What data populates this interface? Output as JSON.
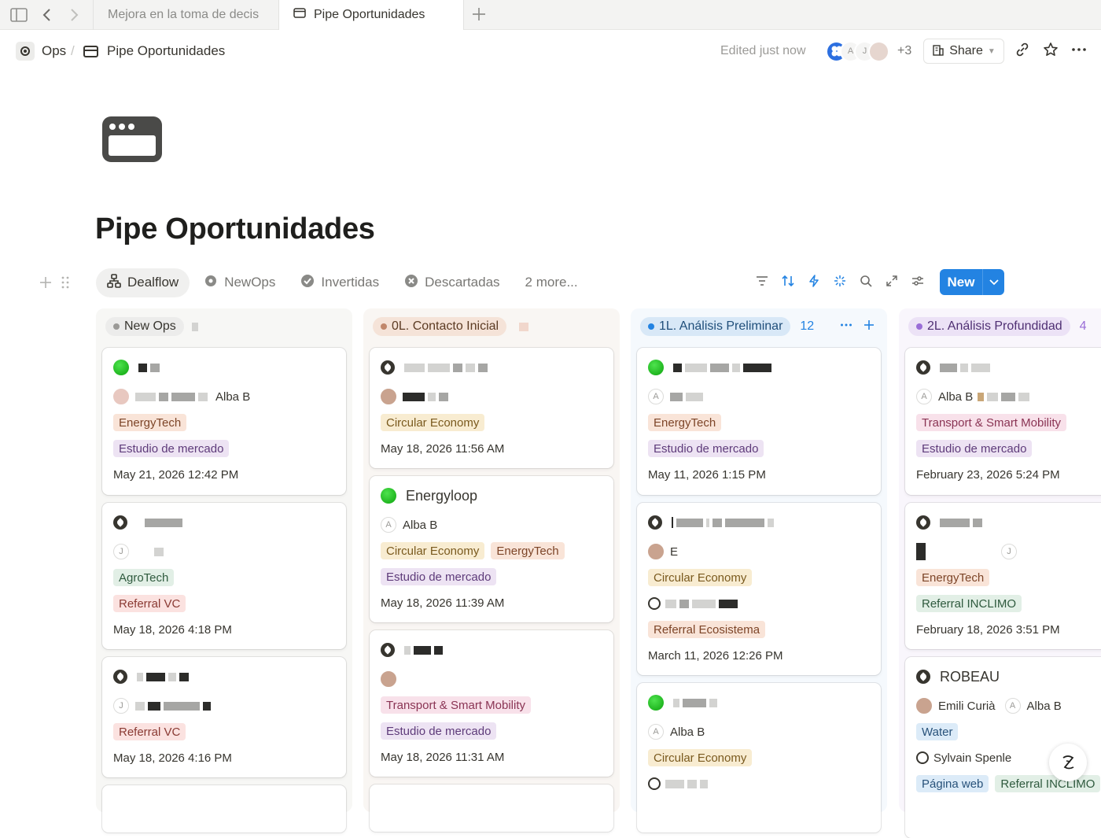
{
  "tabs": [
    {
      "label": "Mejora en la toma de decis"
    },
    {
      "label": "Pipe Oportunidades"
    }
  ],
  "breadcrumb": {
    "workspace": "Ops",
    "separator": "/",
    "page": "Pipe Oportunidades"
  },
  "header": {
    "edited": "Edited just now",
    "avatar_letter_a": "A",
    "avatar_letter_j": "J",
    "extra_count": "+3",
    "share_label": "Share"
  },
  "title": "Pipe Oportunidades",
  "views": [
    {
      "label": "Dealflow",
      "icon": "sitemap-icon"
    },
    {
      "label": "NewOps",
      "icon": "gear-badge-icon"
    },
    {
      "label": "Invertidas",
      "icon": "verified-badge-icon"
    },
    {
      "label": "Descartadas",
      "icon": "x-circle-icon"
    },
    {
      "label": "2 more..."
    }
  ],
  "new_button": "New",
  "columns": [
    {
      "label": "New Ops",
      "color": "#9b9a97",
      "tag_bg": "#ececeb",
      "tag_fg": "#37352f",
      "bg": "#f7f7f5",
      "cards": [
        {
          "assignee": "Alba B",
          "tags1": [
            "EnergyTech"
          ],
          "tags2": [
            "Estudio de mercado"
          ],
          "date": "May 21, 2026 12:42 PM"
        },
        {
          "avatar_letter": "J",
          "tags1": [
            "AgroTech"
          ],
          "tags2": [
            "Referral VC"
          ],
          "date": "May 18, 2026 4:18 PM"
        },
        {
          "avatar_letter": "J",
          "tags1": [
            "Referral VC"
          ],
          "date": "May 18, 2026 4:16 PM"
        }
      ]
    },
    {
      "label": "0L. Contacto Inicial",
      "color": "#c1876b",
      "tag_bg": "#f5e3d8",
      "tag_fg": "#5c3b23",
      "bg": "#f9f6f3",
      "cards": [
        {
          "tags1": [
            "Circular Economy"
          ],
          "date": "May 18, 2026 11:56 AM"
        },
        {
          "title": "Energyloop",
          "avatar_letter": "A",
          "assignee": "Alba B",
          "tags1": [
            "Circular Economy",
            "EnergyTech"
          ],
          "tags2": [
            "Estudio de mercado"
          ],
          "date": "May 18, 2026 11:39 AM"
        },
        {
          "tags1": [
            "Transport & Smart Mobility"
          ],
          "tags2": [
            "Estudio de mercado"
          ],
          "date": "May 18, 2026 11:31 AM"
        }
      ]
    },
    {
      "label": "1L. Análisis Preliminar",
      "count": "12",
      "color": "#2383e2",
      "tag_bg": "#d8e8f7",
      "tag_fg": "#1f4e7a",
      "bg": "#f5f9fd",
      "cards": [
        {
          "avatar_letter": "A",
          "tags1": [
            "EnergyTech"
          ],
          "tags2": [
            "Estudio de mercado"
          ],
          "date": "May 11, 2026 1:15 PM"
        },
        {
          "person_initial": "E",
          "tags1": [
            "Circular Economy"
          ],
          "tags2": [
            "Referral Ecosistema"
          ],
          "date": "March 11, 2026 12:26 PM"
        },
        {
          "avatar_letter": "A",
          "assignee": "Alba B",
          "tags1": [
            "Circular Economy"
          ]
        }
      ]
    },
    {
      "label": "2L. Análisis Profundidad",
      "count": "4",
      "color": "#9a6dd7",
      "tag_bg": "#ece2f6",
      "tag_fg": "#4f2f73",
      "bg": "#f9f6fc",
      "cards": [
        {
          "avatar_letter": "A",
          "assignee": "Alba B",
          "tags1": [
            "Transport & Smart Mobility"
          ],
          "tags2": [
            "Estudio de mercado"
          ],
          "date": "February 23, 2026 5:24 PM"
        },
        {
          "avatar_letter": "J",
          "tags1": [
            "EnergyTech"
          ],
          "tags2": [
            "Referral INCLIMO"
          ],
          "date": "February 18, 2026 3:51 PM"
        },
        {
          "title": "ROBEAU",
          "person": "Emili Curià",
          "avatar_letter": "A",
          "assignee": "Alba B",
          "tags1": [
            "Water"
          ],
          "contact": "Sylvain Spenle",
          "tags2": [
            "Página web",
            "Referral INCLIMO"
          ]
        }
      ]
    }
  ],
  "colors": {
    "accent": "#2383e2",
    "text": "#37352f",
    "muted": "#9b9a97"
  }
}
